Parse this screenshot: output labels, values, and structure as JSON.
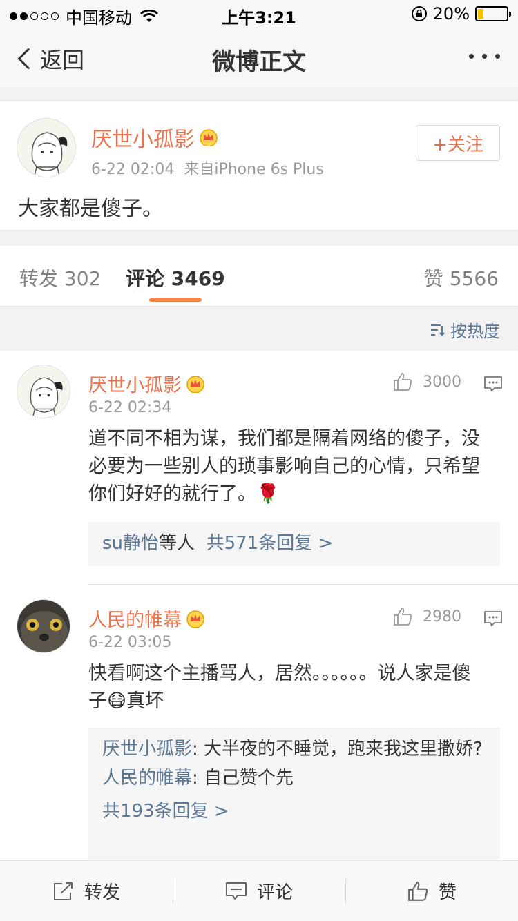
{
  "status_bar": {
    "carrier": "中国移动",
    "time": "上午3:21",
    "battery": "20%",
    "battery_level": 0.2
  },
  "nav": {
    "back_label": "返回",
    "title": "微博正文"
  },
  "post": {
    "username": "厌世小孤影",
    "time": "6-22 02:04",
    "source": "来自iPhone 6s Plus",
    "follow_label": "+关注",
    "text": "大家都是傻子。"
  },
  "tabs": {
    "repost_label": "转发",
    "repost_count": "302",
    "comment_label": "评论",
    "comment_count": "3469",
    "like_label": "赞",
    "like_count": "5566"
  },
  "sort": {
    "label": "按热度"
  },
  "comments": [
    {
      "username": "厌世小孤影",
      "time": "6-22 02:34",
      "likes": "3000",
      "text": "道不同不相为谋，我们都是隔着网络的傻子，没必要为一些别人的琐事影响自己的心情，只希望你们好好的就行了。🌹",
      "replies_user": "su静怡",
      "replies_suffix": "等人",
      "replies_total": "共571条回复 >"
    },
    {
      "username": "人民的帷幕",
      "time": "6-22 03:05",
      "likes": "2980",
      "text": "快看啊这个主播骂人，居然。。。。。。说人家是傻子😷真坏",
      "reply1_user": "厌世小孤影",
      "reply1_text": ": 大半夜的不睡觉，跑来我这里撒娇?",
      "reply2_user": "人民的帷幕",
      "reply2_text": ": 自己赞个先",
      "replies_total": "共193条回复 >"
    }
  ],
  "toolbar": {
    "repost": "转发",
    "comment": "评论",
    "like": "赞"
  }
}
